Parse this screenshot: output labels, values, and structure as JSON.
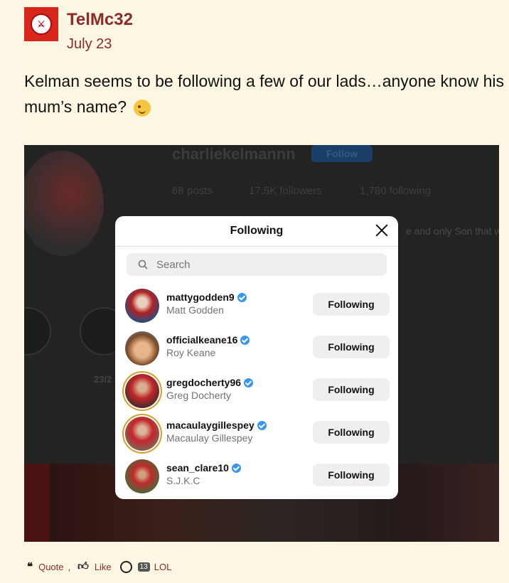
{
  "post": {
    "username": "TelMc32",
    "date": "July 23",
    "text": "Kelman seems to be following a few of our lads…anyone know his mum’s name?"
  },
  "screenshot": {
    "profile_handle": "charliekelmannn",
    "follow_label": "Follow",
    "posts": "68 posts",
    "followers": "17.5K followers",
    "following": "1,780 following",
    "bio_fragment": "e and only Son that w",
    "highlight_date": "23/2"
  },
  "modal": {
    "title": "Following",
    "search_placeholder": "Search",
    "items": [
      {
        "username": "mattygodden9",
        "full_name": "Matt Godden",
        "button": "Following"
      },
      {
        "username": "officialkeane16",
        "full_name": "Roy Keane",
        "button": "Following"
      },
      {
        "username": "gregdocherty96",
        "full_name": "Greg Docherty",
        "button": "Following"
      },
      {
        "username": "macaulaygillespey",
        "full_name": "Macaulay Gillespey",
        "button": "Following"
      },
      {
        "username": "sean_clare10",
        "full_name": "S.J.K.C",
        "button": "Following"
      }
    ]
  },
  "footer": {
    "quote_label": "Quote",
    "like_label": "Like",
    "lol_count": "13",
    "lol_label": "LOL"
  },
  "colors": {
    "accent": "#8c2b27",
    "verified": "#3897f0",
    "background": "#fcf6e3"
  }
}
